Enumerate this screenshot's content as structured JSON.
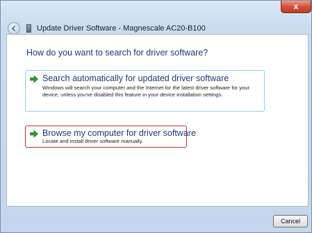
{
  "window": {
    "title": "Update Driver Software - Magnescale AC20-B100",
    "close_label": "x"
  },
  "main": {
    "heading": "How do you want to search for driver software?",
    "options": [
      {
        "title": "Search automatically for updated driver software",
        "description": "Windows will search your computer and the Internet for the latest driver software for your device, unless you've disabled this feature in your device installation settings.",
        "icon": "green-arrow-icon"
      },
      {
        "title": "Browse my computer for driver software",
        "description": "Locate and install driver software manually.",
        "icon": "green-arrow-icon"
      }
    ]
  },
  "footer": {
    "cancel_label": "Cancel"
  },
  "colors": {
    "accent_link": "#1c3a73",
    "selected_border": "#d9253a",
    "hover_border": "#8cd1e8",
    "arrow": "#2e9a2e"
  }
}
